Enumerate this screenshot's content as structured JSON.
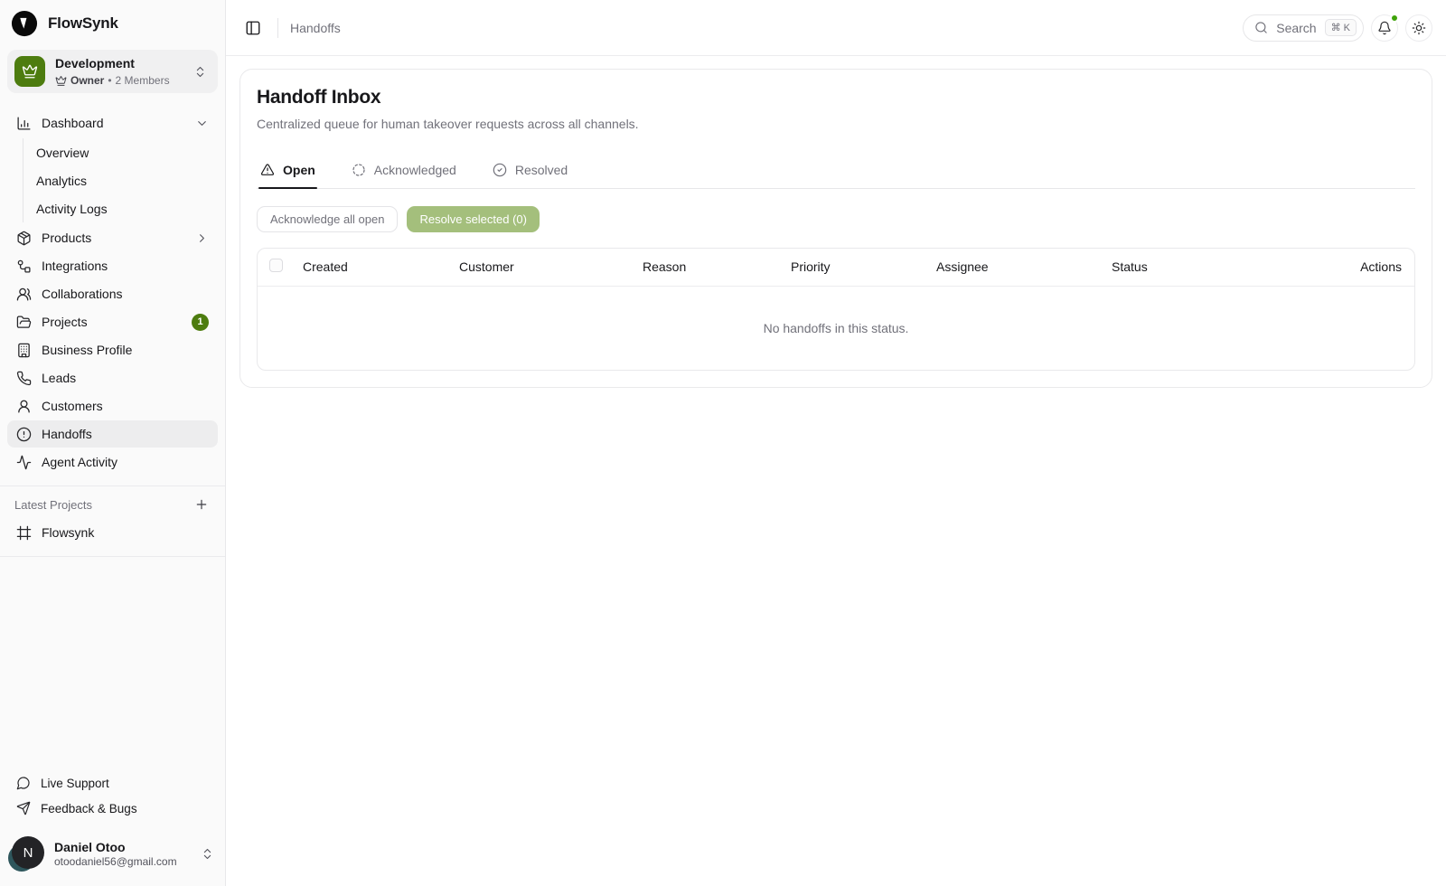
{
  "brand": {
    "name": "FlowSynk"
  },
  "workspace": {
    "name": "Development",
    "role": "Owner",
    "separator": "•",
    "members": "2 Members"
  },
  "sidebar": {
    "nav": [
      {
        "label": "Dashboard",
        "icon": "bar-chart",
        "expanded": true,
        "children": [
          "Overview",
          "Analytics",
          "Activity Logs"
        ]
      },
      {
        "label": "Products",
        "icon": "package",
        "chevron": "right"
      },
      {
        "label": "Integrations",
        "icon": "workflow"
      },
      {
        "label": "Collaborations",
        "icon": "users"
      },
      {
        "label": "Projects",
        "icon": "folder-open",
        "badge": "1"
      },
      {
        "label": "Business Profile",
        "icon": "building"
      },
      {
        "label": "Leads",
        "icon": "phone"
      },
      {
        "label": "Customers",
        "icon": "user"
      },
      {
        "label": "Handoffs",
        "icon": "alert-circle",
        "active": true
      },
      {
        "label": "Agent Activity",
        "icon": "activity"
      }
    ],
    "projects_section": {
      "label": "Latest Projects",
      "items": [
        {
          "label": "Flowsynk",
          "icon": "frame"
        }
      ]
    },
    "footer_links": [
      {
        "label": "Live Support",
        "icon": "message-circle"
      },
      {
        "label": "Feedback & Bugs",
        "icon": "send"
      }
    ],
    "user": {
      "name": "Daniel Otoo",
      "email": "otoodaniel56@gmail.com",
      "avatar_initial": "N"
    }
  },
  "topbar": {
    "breadcrumb": "Handoffs",
    "search": {
      "label": "Search",
      "kbd": "⌘ K"
    }
  },
  "main": {
    "title": "Handoff Inbox",
    "subtitle": "Centralized queue for human takeover requests across all channels.",
    "tabs": [
      {
        "label": "Open",
        "icon": "alert-triangle",
        "active": true
      },
      {
        "label": "Acknowledged",
        "icon": "dashed-circle",
        "active": false
      },
      {
        "label": "Resolved",
        "icon": "check-circle",
        "active": false
      }
    ],
    "actions": {
      "acknowledge_all": "Acknowledge all open",
      "resolve_selected": "Resolve selected (0)"
    },
    "table": {
      "columns": [
        "Created",
        "Customer",
        "Reason",
        "Priority",
        "Assignee",
        "Status",
        "Actions"
      ],
      "empty_message": "No handoffs in this status."
    }
  },
  "colors": {
    "brand_green": "#4d7c0f",
    "resolve_button": "#a4bf7c",
    "notification_dot": "#3fa30a"
  }
}
